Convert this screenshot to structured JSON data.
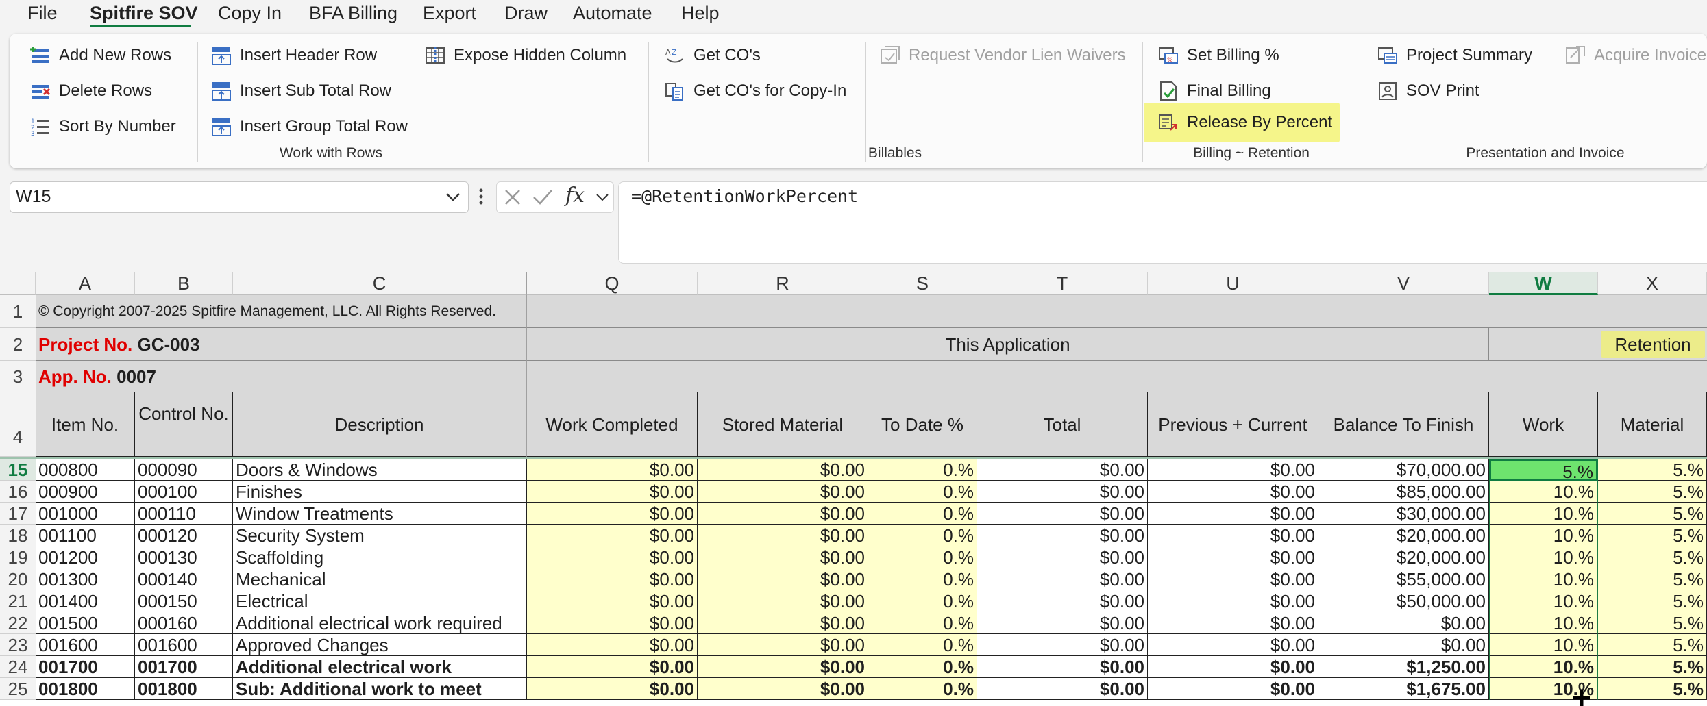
{
  "menu": {
    "items": [
      "File",
      "Spitfire SOV",
      "Copy In",
      "BFA Billing",
      "Export",
      "Draw",
      "Automate",
      "Help"
    ],
    "active": "Spitfire SOV"
  },
  "ribbon": {
    "work_with_rows": {
      "label": "Work with Rows",
      "add_new_rows": "Add New Rows",
      "delete_rows": "Delete Rows",
      "sort_by_number": "Sort By Number",
      "insert_header_row": "Insert Header Row",
      "insert_sub_total_row": "Insert Sub Total Row",
      "insert_group_total_row": "Insert Group Total Row",
      "expose_hidden_column": "Expose Hidden Column"
    },
    "billables": {
      "label": "Billables",
      "get_cos": "Get CO's",
      "get_cos_copy_in": "Get CO's for Copy-In",
      "request_vendor_lien_waivers": "Request Vendor Lien Waivers"
    },
    "billing_retention": {
      "label": "Billing ~ Retention",
      "set_billing_pct": "Set Billing %",
      "final_billing": "Final Billing",
      "release_by_percent": "Release By Percent"
    },
    "presentation": {
      "label": "Presentation and Invoice",
      "project_summary": "Project Summary",
      "sov_print": "SOV Print",
      "acquire_invoice": "Acquire Invoice"
    }
  },
  "formula_bar": {
    "name_box": "W15",
    "formula": "=@RetentionWorkPercent"
  },
  "sheet": {
    "columns": [
      "A",
      "B",
      "C",
      "Q",
      "R",
      "S",
      "T",
      "U",
      "V",
      "W",
      "X"
    ],
    "selected_column": "W",
    "copyright": "© Copyright 2007-2025 Spitfire Management, LLC. All Rights Reserved.",
    "project_label": "Project No.",
    "project_no": "GC-003",
    "app_label": "App. No.",
    "app_no": "0007",
    "this_application": "This Application",
    "retention": "Retention",
    "headers": [
      "Item No.",
      "Control No.",
      "Description",
      "Work Completed",
      "Stored Material",
      "To Date %",
      "Total",
      "Previous + Current",
      "Balance To Finish",
      "Work",
      "Material"
    ],
    "header_row_numbers": [
      "1",
      "2",
      "3",
      "4"
    ],
    "selected_row": "15",
    "rows": [
      {
        "row": "15",
        "item": "000800",
        "control": "000090",
        "desc": "Doors & Windows",
        "q": "$0.00",
        "r": "$0.00",
        "s": "0.%",
        "t": "$0.00",
        "u": "$0.00",
        "v": "$70,000.00",
        "w": "5.%",
        "x": "5.%",
        "bold": false
      },
      {
        "row": "16",
        "item": "000900",
        "control": "000100",
        "desc": "Finishes",
        "q": "$0.00",
        "r": "$0.00",
        "s": "0.%",
        "t": "$0.00",
        "u": "$0.00",
        "v": "$85,000.00",
        "w": "10.%",
        "x": "5.%",
        "bold": false
      },
      {
        "row": "17",
        "item": "001000",
        "control": "000110",
        "desc": "Window Treatments",
        "q": "$0.00",
        "r": "$0.00",
        "s": "0.%",
        "t": "$0.00",
        "u": "$0.00",
        "v": "$30,000.00",
        "w": "10.%",
        "x": "5.%",
        "bold": false
      },
      {
        "row": "18",
        "item": "001100",
        "control": "000120",
        "desc": "Security System",
        "q": "$0.00",
        "r": "$0.00",
        "s": "0.%",
        "t": "$0.00",
        "u": "$0.00",
        "v": "$20,000.00",
        "w": "10.%",
        "x": "5.%",
        "bold": false
      },
      {
        "row": "19",
        "item": "001200",
        "control": "000130",
        "desc": "Scaffolding",
        "q": "$0.00",
        "r": "$0.00",
        "s": "0.%",
        "t": "$0.00",
        "u": "$0.00",
        "v": "$20,000.00",
        "w": "10.%",
        "x": "5.%",
        "bold": false
      },
      {
        "row": "20",
        "item": "001300",
        "control": "000140",
        "desc": "Mechanical",
        "q": "$0.00",
        "r": "$0.00",
        "s": "0.%",
        "t": "$0.00",
        "u": "$0.00",
        "v": "$55,000.00",
        "w": "10.%",
        "x": "5.%",
        "bold": false
      },
      {
        "row": "21",
        "item": "001400",
        "control": "000150",
        "desc": "Electrical",
        "q": "$0.00",
        "r": "$0.00",
        "s": "0.%",
        "t": "$0.00",
        "u": "$0.00",
        "v": "$50,000.00",
        "w": "10.%",
        "x": "5.%",
        "bold": false
      },
      {
        "row": "22",
        "item": "001500",
        "control": "000160",
        "desc": "Additional electrical work required",
        "q": "$0.00",
        "r": "$0.00",
        "s": "0.%",
        "t": "$0.00",
        "u": "$0.00",
        "v": "$0.00",
        "w": "10.%",
        "x": "5.%",
        "bold": false
      },
      {
        "row": "23",
        "item": "001600",
        "control": "001600",
        "desc": "Approved Changes",
        "q": "$0.00",
        "r": "$0.00",
        "s": "0.%",
        "t": "$0.00",
        "u": "$0.00",
        "v": "$0.00",
        "w": "10.%",
        "x": "5.%",
        "bold": false
      },
      {
        "row": "24",
        "item": "001700",
        "control": "001700",
        "desc": "Additional electrical work",
        "q": "$0.00",
        "r": "$0.00",
        "s": "0.%",
        "t": "$0.00",
        "u": "$0.00",
        "v": "$1,250.00",
        "w": "10.%",
        "x": "5.%",
        "bold": true
      },
      {
        "row": "25",
        "item": "001800",
        "control": "001800",
        "desc": "Sub: Additional work to meet",
        "q": "$0.00",
        "r": "$0.00",
        "s": "0.%",
        "t": "$0.00",
        "u": "$0.00",
        "v": "$1,675.00",
        "w": "10.%",
        "x": "5.%",
        "bold": true
      }
    ]
  },
  "colors": {
    "accent": "#107c41",
    "highlight": "#f5f58a",
    "input_yellow": "#ffffcc",
    "header_gray": "#d9d9d9",
    "selected_green": "#6ee36e",
    "label_red": "#e00000"
  }
}
